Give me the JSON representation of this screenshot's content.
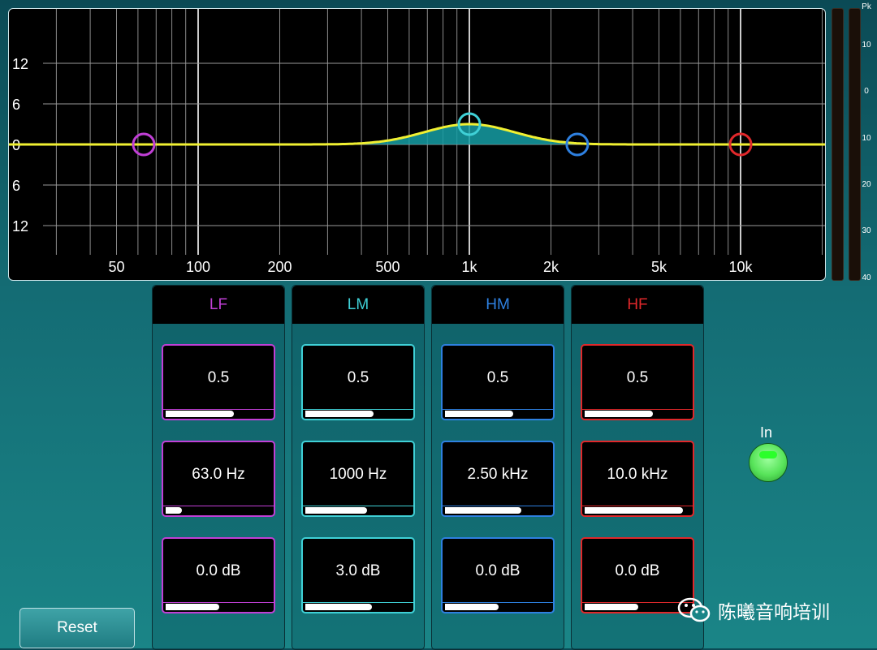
{
  "graph": {
    "y_labels": [
      "12",
      "6",
      "0",
      "6",
      "12"
    ],
    "x_labels": [
      "50",
      "100",
      "200",
      "500",
      "1k",
      "2k",
      "5k",
      "10k"
    ],
    "curve_color": "#f0f032",
    "fill_color": "#159ea5"
  },
  "meter": {
    "labels": [
      "Pk",
      "10",
      "0",
      "10",
      "20",
      "30",
      "40"
    ]
  },
  "bands": [
    {
      "name": "LF",
      "color": "#c13fd6",
      "q": "0.5",
      "freq": "63.0 Hz",
      "gain": "0.0 dB",
      "q_level": 0.62,
      "freq_level": 0.15,
      "gain_level": 0.5
    },
    {
      "name": "LM",
      "color": "#3fd0d6",
      "q": "0.5",
      "freq": "1000 Hz",
      "gain": "3.0 dB",
      "q_level": 0.62,
      "freq_level": 0.56,
      "gain_level": 0.6
    },
    {
      "name": "HM",
      "color": "#2e80e0",
      "q": "0.5",
      "freq": "2.50 kHz",
      "gain": "0.0 dB",
      "q_level": 0.62,
      "freq_level": 0.7,
      "gain_level": 0.5
    },
    {
      "name": "HF",
      "color": "#e0282b",
      "q": "0.5",
      "freq": "10.0 kHz",
      "gain": "0.0 dB",
      "q_level": 0.62,
      "freq_level": 0.9,
      "gain_level": 0.5
    }
  ],
  "reset_label": "Reset",
  "in_label": "In",
  "watermark_text": "陈曦音响培训"
}
